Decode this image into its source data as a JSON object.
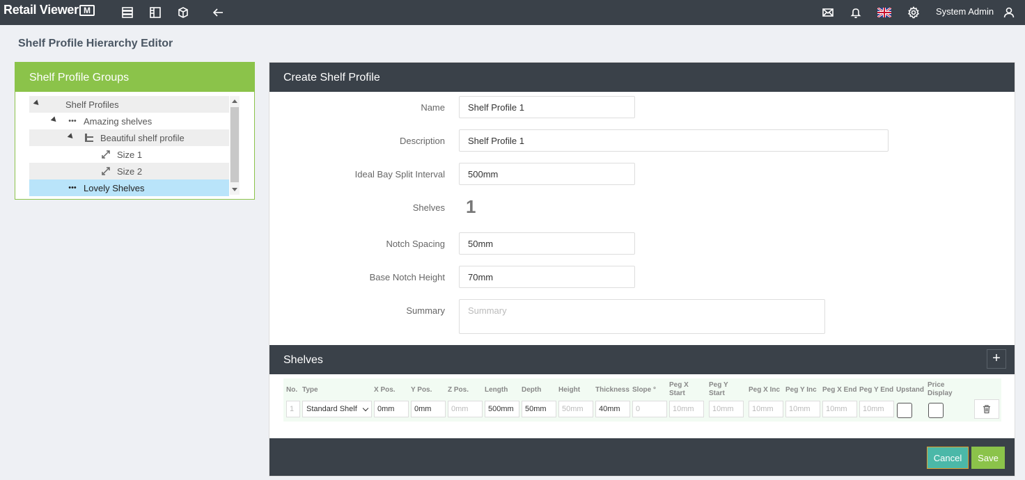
{
  "app": {
    "name": "Retail Viewer",
    "logo_badge": "M"
  },
  "topbar": {
    "icons": [
      "list-icon",
      "columns-icon",
      "box-icon",
      "back-arrow-icon",
      "mail-icon",
      "bell-icon",
      "uk-flag-icon",
      "gear-icon",
      "user-icon"
    ],
    "user_name": "System Admin"
  },
  "page": {
    "title": "Shelf Profile Hierarchy Editor"
  },
  "groups": {
    "title": "Shelf Profile Groups",
    "tree": [
      {
        "label": "Shelf Profiles",
        "level": 0,
        "icon": ""
      },
      {
        "label": "Amazing shelves",
        "level": 1,
        "icon": "ellipsis-icon"
      },
      {
        "label": "Beautiful shelf profile",
        "level": 2,
        "icon": "shelf-icon"
      },
      {
        "label": "Size 1",
        "level": 3,
        "icon": "resize-icon"
      },
      {
        "label": "Size 2",
        "level": 3,
        "icon": "resize-icon"
      },
      {
        "label": "Lovely Shelves",
        "level": 1,
        "icon": "ellipsis-icon",
        "selected": true
      }
    ]
  },
  "form": {
    "title": "Create Shelf Profile",
    "name_label": "Name",
    "name_value": "Shelf Profile 1",
    "description_label": "Description",
    "description_value": "Shelf Profile 1",
    "bay_split_label": "Ideal Bay Split Interval",
    "bay_split_value": "500mm",
    "shelves_label": "Shelves",
    "shelves_value": "1",
    "notch_spacing_label": "Notch Spacing",
    "notch_spacing_value": "50mm",
    "base_notch_label": "Base Notch Height",
    "base_notch_value": "70mm",
    "summary_label": "Summary",
    "summary_placeholder": "Summary"
  },
  "shelves": {
    "title": "Shelves",
    "add_label": "+",
    "columns": {
      "no": "No.",
      "type": "Type",
      "x_pos": "X Pos.",
      "y_pos": "Y Pos.",
      "z_pos": "Z Pos.",
      "length": "Length",
      "depth": "Depth",
      "height": "Height",
      "thickness": "Thickness",
      "slope": "Slope °",
      "peg_x_start": "Peg X Start",
      "peg_y_start": "Peg Y Start",
      "peg_x_inc": "Peg X Inc",
      "peg_y_inc": "Peg Y Inc",
      "peg_x_end": "Peg X End",
      "peg_y_end": "Peg Y End",
      "upstand": "Upstand",
      "price_display": "Price Display"
    },
    "row": {
      "no_placeholder": "1",
      "type": "Standard Shelf",
      "x_pos": "0mm",
      "y_pos": "0mm",
      "z_pos_placeholder": "0mm",
      "length": "500mm",
      "depth": "50mm",
      "height_placeholder": "50mm",
      "thickness": "40mm",
      "slope_placeholder": "0",
      "peg_x_start_placeholder": "10mm",
      "peg_y_start_placeholder": "10mm",
      "peg_x_inc_placeholder": "10mm",
      "peg_y_inc_placeholder": "10mm",
      "peg_x_end_placeholder": "10mm",
      "peg_y_end_placeholder": "10mm"
    }
  },
  "footer": {
    "cancel_label": "Cancel",
    "save_label": "Save"
  }
}
